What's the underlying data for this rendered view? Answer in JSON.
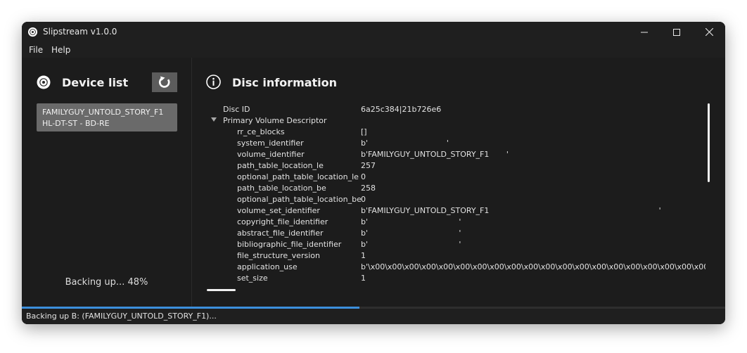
{
  "window": {
    "title": "Slipstream v1.0.0"
  },
  "menu": {
    "file": "File",
    "help": "Help"
  },
  "sidebar": {
    "title": "Device list",
    "devices": [
      {
        "line1": "FAMILYGUY_UNTOLD_STORY_F1",
        "line2": "HL-DT-ST - BD-RE"
      }
    ],
    "status": "Backing up... 48%"
  },
  "main": {
    "title": "Disc information",
    "disc_id_label": "Disc ID",
    "disc_id_value": "6a25c384|21b726e6",
    "pvd_label": "Primary Volume Descriptor",
    "fields": [
      {
        "key": "rr_ce_blocks",
        "value": "[]"
      },
      {
        "key": "system_identifier",
        "value": "b'                                '"
      },
      {
        "key": "volume_identifier",
        "value": "b'FAMILYGUY_UNTOLD_STORY_F1       '"
      },
      {
        "key": "path_table_location_le",
        "value": "257"
      },
      {
        "key": "optional_path_table_location_le",
        "value": "0"
      },
      {
        "key": "path_table_location_be",
        "value": "258"
      },
      {
        "key": "optional_path_table_location_be",
        "value": "0"
      },
      {
        "key": "volume_set_identifier",
        "value": "b'FAMILYGUY_UNTOLD_STORY_F1                                                                     '"
      },
      {
        "key": "copyright_file_identifier",
        "value": "b'                                     '"
      },
      {
        "key": "abstract_file_identifier",
        "value": "b'                                     '"
      },
      {
        "key": "bibliographic_file_identifier",
        "value": "b'                                     '"
      },
      {
        "key": "file_structure_version",
        "value": "1"
      },
      {
        "key": "application_use",
        "value": "b'\\x00\\x00\\x00\\x00\\x00\\x00\\x00\\x00\\x00\\x00\\x00\\x00\\x00\\x00\\x00\\x00\\x00\\x00\\x00\\x00\\x00\\x00\\x00"
      },
      {
        "key": "set_size",
        "value": "1"
      }
    ]
  },
  "progress": 0.48,
  "statusbar": {
    "text": "Backing up B: (FAMILYGUY_UNTOLD_STORY_F1)..."
  }
}
